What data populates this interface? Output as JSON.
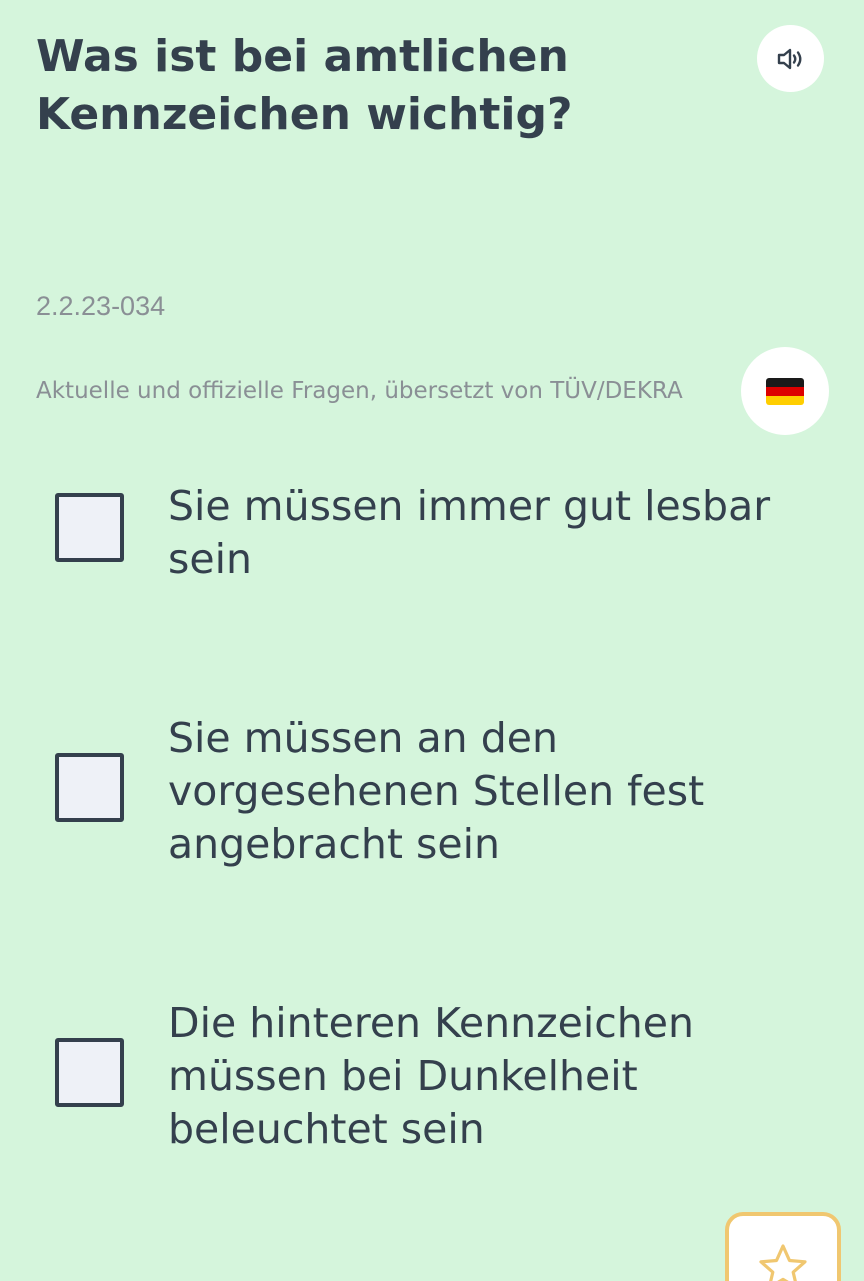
{
  "question": {
    "title": "Was ist bei amtlichen Kennzeichen wichtig?",
    "id": "2.2.23-034",
    "source_note": "Aktuelle und offizielle Fragen, übersetzt von TÜV/DEKRA"
  },
  "audio_button": {
    "icon": "speaker-icon"
  },
  "language_button": {
    "icon": "german-flag-icon",
    "flag_colors": [
      "#1a1a1a",
      "#dd0000",
      "#ffce00"
    ]
  },
  "answers": [
    {
      "text": "Sie müssen immer gut lesbar sein",
      "checked": false
    },
    {
      "text": "Sie müssen an den vorgesehenen Stellen fest angebracht sein",
      "checked": false
    },
    {
      "text": "Die hinteren Kennzeichen müssen bei Dunkelheit beleuchtet sein",
      "checked": false
    }
  ],
  "favorite_button": {
    "icon": "star-icon"
  },
  "colors": {
    "background": "#d5f5dc",
    "text": "#34404d",
    "muted": "#8a8f95",
    "checkbox_fill": "#eef1f7",
    "favorite_border": "#f0c770"
  }
}
